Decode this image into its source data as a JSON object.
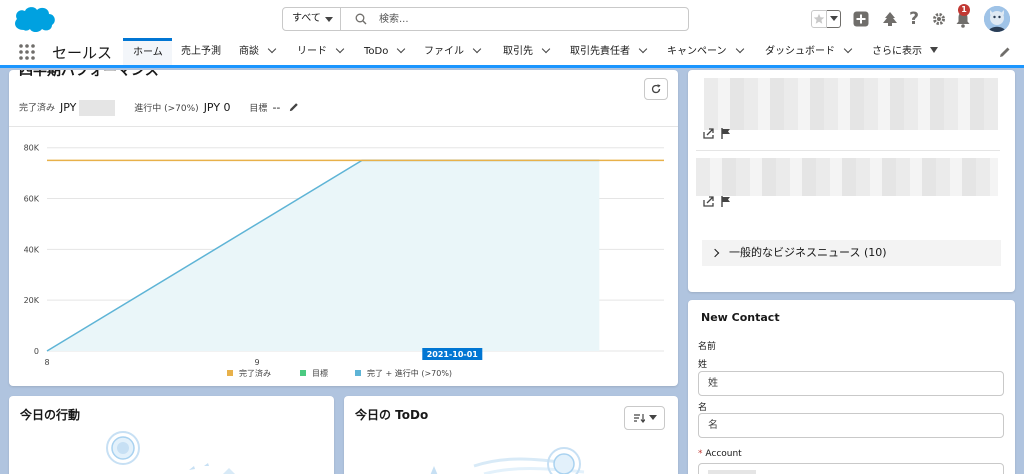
{
  "header": {
    "search": {
      "scope_label": "すべて",
      "placeholder": "検索..."
    },
    "notification_count": "1"
  },
  "nav": {
    "app_name": "セールス",
    "tabs": [
      {
        "label": "ホーム",
        "active": true,
        "dropdown": false
      },
      {
        "label": "売上予測",
        "dropdown": false
      },
      {
        "label": "商談",
        "dropdown": true
      },
      {
        "label": "リード",
        "dropdown": true
      },
      {
        "label": "ToDo",
        "dropdown": true
      },
      {
        "label": "ファイル",
        "dropdown": true
      },
      {
        "label": "取引先",
        "dropdown": true
      },
      {
        "label": "取引先責任者",
        "dropdown": true
      },
      {
        "label": "キャンペーン",
        "dropdown": true
      },
      {
        "label": "ダッシュボード",
        "dropdown": true
      },
      {
        "label": "さらに表示",
        "dropdown": true
      }
    ]
  },
  "performance": {
    "title": "四半期パフォーマンス",
    "closed_label": "完了済み",
    "closed_currency": "JPY",
    "open_label": "進行中 (>70%)",
    "open_value": "JPY 0",
    "goal_label": "目標",
    "goal_value": "--"
  },
  "chart_data": {
    "type": "line",
    "x": [
      "8",
      "9"
    ],
    "y_ticks": [
      "0",
      "20K",
      "40K",
      "60K",
      "80K"
    ],
    "ylim": [
      0,
      85000
    ],
    "goal_value": 75000,
    "closed_plus_open": [
      [
        0,
        0
      ],
      [
        1.5,
        75000
      ],
      [
        2.63,
        75000
      ]
    ],
    "date_marker": "2021-10-01",
    "legend": [
      {
        "label": "完了済み",
        "color": "#e8b14a"
      },
      {
        "label": "目標",
        "color": "#4bca81"
      },
      {
        "label": "完了 + 進行中 (>70%)",
        "color": "#5eb4d6"
      }
    ],
    "colors": {
      "goal_line": "#e8b14a",
      "area_fill": "#eaf6f9",
      "area_line": "#5eb4d6",
      "marker_bg": "#0176d3"
    }
  },
  "news": {
    "accordion_label": "一般的なビジネスニュース (10)"
  },
  "new_contact": {
    "title": "New Contact",
    "name_section": "名前",
    "last_name_label": "姓",
    "last_name_placeholder": "姓",
    "first_name_label": "名",
    "first_name_placeholder": "名",
    "account_label": "Account",
    "required_mark": "*"
  },
  "events": {
    "title": "今日の行動"
  },
  "todo": {
    "title": "今日の ToDo"
  }
}
